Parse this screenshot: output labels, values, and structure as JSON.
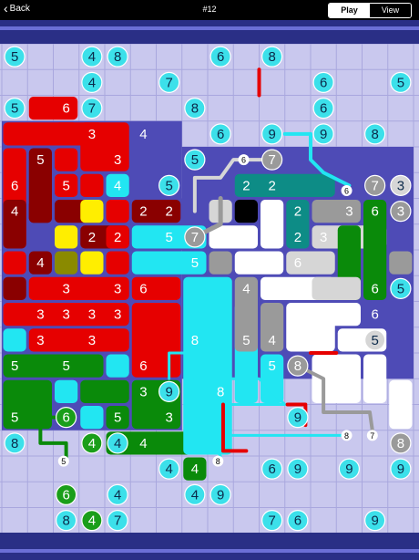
{
  "nav": {
    "back_label": "Back",
    "title": "#12"
  },
  "tabs": [
    {
      "label": "Play",
      "active": true
    },
    {
      "label": "View",
      "active": false
    }
  ],
  "colors": {
    "board": "#c9c8ee",
    "grid": "#a9a7de",
    "frame": "#2a2f86",
    "red": "#e60000",
    "darkred": "#8a0000",
    "cyan": "#22e6f2",
    "teal": "#0d8c86",
    "green": "#0a8a0a",
    "gray": "#9a9a9a",
    "lightgray": "#d6d6d6",
    "white": "#ffffff",
    "yellow": "#ffee00",
    "olive": "#8a8a00",
    "purple": "#4e4bb6",
    "black": "#000000",
    "circle": "#3ce0ea",
    "circle_green": "#1a9e1a"
  },
  "clues": [
    {
      "t": "5",
      "c": "cyan",
      "x": 0,
      "y": 0
    },
    {
      "t": "4",
      "c": "cyan",
      "x": 3,
      "y": 0
    },
    {
      "t": "8",
      "c": "cyan",
      "x": 4,
      "y": 0
    },
    {
      "t": "6",
      "c": "cyan",
      "x": 8,
      "y": 0
    },
    {
      "t": "8",
      "c": "cyan",
      "x": 10,
      "y": 0
    },
    {
      "t": "4",
      "c": "cyan",
      "x": 3,
      "y": 1
    },
    {
      "t": "7",
      "c": "cyan",
      "x": 6,
      "y": 1
    },
    {
      "t": "6",
      "c": "cyan",
      "x": 12,
      "y": 1
    },
    {
      "t": "5",
      "c": "cyan",
      "x": 15,
      "y": 1
    },
    {
      "t": "5",
      "c": "cyan",
      "x": 0,
      "y": 2
    },
    {
      "t": "7",
      "c": "cyan",
      "x": 3,
      "y": 2
    },
    {
      "t": "8",
      "c": "cyan",
      "x": 7,
      "y": 2
    },
    {
      "t": "6",
      "c": "cyan",
      "x": 12,
      "y": 2
    },
    {
      "t": "6",
      "c": "cyan",
      "x": 8,
      "y": 3
    },
    {
      "t": "9",
      "c": "cyan",
      "x": 10,
      "y": 3
    },
    {
      "t": "9",
      "c": "cyan",
      "x": 12,
      "y": 3
    },
    {
      "t": "8",
      "c": "cyan",
      "x": 14,
      "y": 3
    },
    {
      "t": "5",
      "c": "cyan",
      "x": 7,
      "y": 4
    },
    {
      "t": "7",
      "c": "gray",
      "x": 10,
      "y": 4
    },
    {
      "t": "5",
      "c": "cyan",
      "x": 6,
      "y": 5
    },
    {
      "t": "7",
      "c": "gray",
      "x": 14,
      "y": 5
    },
    {
      "t": "3",
      "c": "lightgray",
      "x": 15,
      "y": 5
    },
    {
      "t": "7",
      "c": "gray",
      "x": 7,
      "y": 7
    },
    {
      "t": "3",
      "c": "gray",
      "x": 15,
      "y": 6
    },
    {
      "t": "5",
      "c": "cyan",
      "x": 15,
      "y": 9
    },
    {
      "t": "5",
      "c": "lightgray",
      "x": 14,
      "y": 11
    },
    {
      "t": "8",
      "c": "gray",
      "x": 11,
      "y": 12
    },
    {
      "t": "9",
      "c": "cyan",
      "x": 6,
      "y": 13
    },
    {
      "t": "6",
      "c": "green",
      "x": 2,
      "y": 14
    },
    {
      "t": "9",
      "c": "cyan",
      "x": 11,
      "y": 14
    },
    {
      "t": "8",
      "c": "cyan",
      "x": 0,
      "y": 15
    },
    {
      "t": "4",
      "c": "green",
      "x": 3,
      "y": 15
    },
    {
      "t": "4",
      "c": "cyan",
      "x": 4,
      "y": 15
    },
    {
      "t": "8",
      "c": "gray",
      "x": 15,
      "y": 15
    },
    {
      "t": "4",
      "c": "cyan",
      "x": 6,
      "y": 16
    },
    {
      "t": "6",
      "c": "cyan",
      "x": 10,
      "y": 16
    },
    {
      "t": "9",
      "c": "cyan",
      "x": 11,
      "y": 16
    },
    {
      "t": "9",
      "c": "cyan",
      "x": 13,
      "y": 16
    },
    {
      "t": "9",
      "c": "cyan",
      "x": 15,
      "y": 16
    },
    {
      "t": "6",
      "c": "green",
      "x": 2,
      "y": 17
    },
    {
      "t": "4",
      "c": "cyan",
      "x": 4,
      "y": 17
    },
    {
      "t": "4",
      "c": "cyan",
      "x": 7,
      "y": 17
    },
    {
      "t": "9",
      "c": "cyan",
      "x": 8,
      "y": 17
    },
    {
      "t": "8",
      "c": "cyan",
      "x": 2,
      "y": 18
    },
    {
      "t": "4",
      "c": "green",
      "x": 3,
      "y": 18
    },
    {
      "t": "7",
      "c": "cyan",
      "x": 4,
      "y": 18
    },
    {
      "t": "7",
      "c": "cyan",
      "x": 10,
      "y": 18
    },
    {
      "t": "6",
      "c": "cyan",
      "x": 11,
      "y": 18
    },
    {
      "t": "9",
      "c": "cyan",
      "x": 14,
      "y": 18
    }
  ],
  "cell_labels": [
    {
      "t": "6",
      "x": 2,
      "y": 2
    },
    {
      "t": "3",
      "x": 3,
      "y": 3
    },
    {
      "t": "4",
      "x": 5,
      "y": 3
    },
    {
      "t": "5",
      "x": 1,
      "y": 4
    },
    {
      "t": "3",
      "x": 4,
      "y": 4
    },
    {
      "t": "6",
      "x": 0,
      "y": 5
    },
    {
      "t": "5",
      "x": 2,
      "y": 5
    },
    {
      "t": "4",
      "x": 4,
      "y": 5
    },
    {
      "t": "4",
      "x": 0,
      "y": 6
    },
    {
      "t": "2",
      "x": 5,
      "y": 6
    },
    {
      "t": "2",
      "x": 6,
      "y": 6
    },
    {
      "t": "2",
      "x": 9,
      "y": 5
    },
    {
      "t": "2",
      "x": 10,
      "y": 5
    },
    {
      "t": "2",
      "x": 3,
      "y": 7
    },
    {
      "t": "2",
      "x": 4,
      "y": 7
    },
    {
      "t": "5",
      "x": 6,
      "y": 7
    },
    {
      "t": "6",
      "x": 8,
      "y": 7
    },
    {
      "t": "2",
      "x": 10,
      "y": 6
    },
    {
      "t": "2",
      "x": 11,
      "y": 6
    },
    {
      "t": "3",
      "x": 13,
      "y": 6
    },
    {
      "t": "6",
      "x": 14,
      "y": 6
    },
    {
      "t": "4",
      "x": 1,
      "y": 8
    },
    {
      "t": "5",
      "x": 7,
      "y": 8
    },
    {
      "t": "2",
      "x": 10,
      "y": 7
    },
    {
      "t": "2",
      "x": 11,
      "y": 7
    },
    {
      "t": "3",
      "x": 12,
      "y": 7
    },
    {
      "t": "6",
      "x": 11,
      "y": 8
    },
    {
      "t": "3",
      "x": 2,
      "y": 9
    },
    {
      "t": "3",
      "x": 4,
      "y": 9
    },
    {
      "t": "6",
      "x": 5,
      "y": 9
    },
    {
      "t": "4",
      "x": 9,
      "y": 9
    },
    {
      "t": "6",
      "x": 11,
      "y": 9
    },
    {
      "t": "6",
      "x": 14,
      "y": 9
    },
    {
      "t": "3",
      "x": 1,
      "y": 10
    },
    {
      "t": "3",
      "x": 2,
      "y": 10
    },
    {
      "t": "3",
      "x": 3,
      "y": 10
    },
    {
      "t": "3",
      "x": 4,
      "y": 10
    },
    {
      "t": "6",
      "x": 14,
      "y": 10
    },
    {
      "t": "3",
      "x": 1,
      "y": 11
    },
    {
      "t": "3",
      "x": 3,
      "y": 11
    },
    {
      "t": "8",
      "x": 7,
      "y": 11
    },
    {
      "t": "5",
      "x": 9,
      "y": 11
    },
    {
      "t": "4",
      "x": 10,
      "y": 11
    },
    {
      "t": "5",
      "x": 11,
      "y": 11
    },
    {
      "t": "5",
      "x": 13,
      "y": 11
    },
    {
      "t": "5",
      "x": 0,
      "y": 12
    },
    {
      "t": "5",
      "x": 2,
      "y": 12
    },
    {
      "t": "6",
      "x": 5,
      "y": 12
    },
    {
      "t": "5",
      "x": 10,
      "y": 12
    },
    {
      "t": "5",
      "x": 12,
      "y": 12
    },
    {
      "t": "5",
      "x": 14,
      "y": 12
    },
    {
      "t": "3",
      "x": 5,
      "y": 13
    },
    {
      "t": "8",
      "x": 8,
      "y": 13
    },
    {
      "t": "3",
      "x": 15,
      "y": 13
    },
    {
      "t": "5",
      "x": 0,
      "y": 14
    },
    {
      "t": "5",
      "x": 4,
      "y": 14
    },
    {
      "t": "3",
      "x": 6,
      "y": 14
    },
    {
      "t": "4",
      "x": 5,
      "y": 15
    },
    {
      "t": "4",
      "x": 7,
      "y": 16
    }
  ],
  "path_labels": [
    {
      "t": "6",
      "x": 9.4,
      "y": 4.5
    },
    {
      "t": "6",
      "x": 13.4,
      "y": 5.7
    },
    {
      "t": "8",
      "x": 13.4,
      "y": 15.2
    },
    {
      "t": "7",
      "x": 14.4,
      "y": 15.2
    },
    {
      "t": "8",
      "x": 8.4,
      "y": 16.2
    },
    {
      "t": "5",
      "x": 2.4,
      "y": 16.2
    }
  ]
}
